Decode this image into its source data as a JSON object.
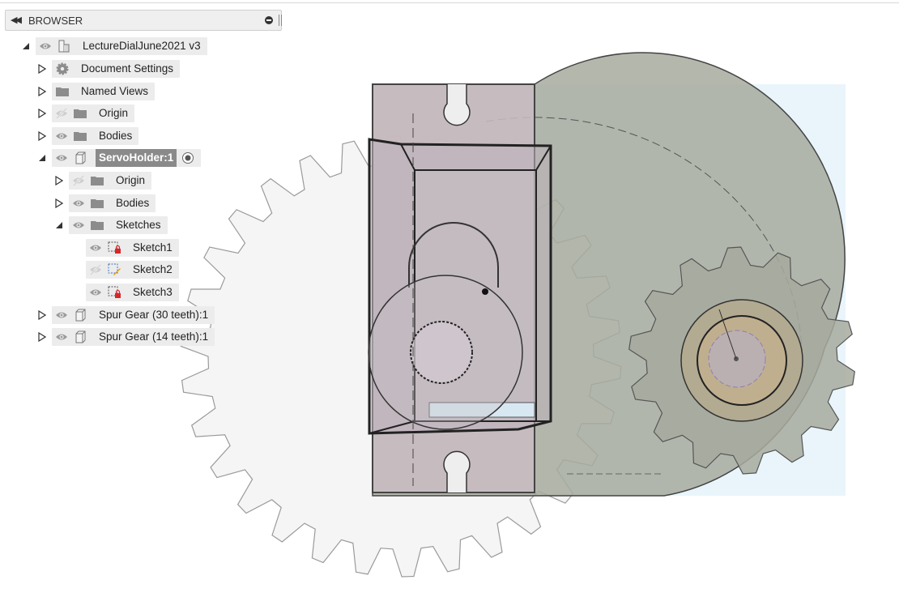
{
  "browser": {
    "title": "BROWSER",
    "collapse_icon": "double-left-arrow-icon",
    "pin_icon": "pin-icon"
  },
  "tree": {
    "root": {
      "label": "LectureDialJune2021 v3",
      "expanded": true
    },
    "items": [
      {
        "label": "Document Settings",
        "icon": "gear-icon",
        "expanded": false
      },
      {
        "label": "Named Views",
        "icon": "folder-icon",
        "expanded": false
      },
      {
        "label": "Origin",
        "icon": "folder-icon",
        "visible": false,
        "expanded": false
      },
      {
        "label": "Bodies",
        "icon": "folder-icon",
        "visible": true,
        "expanded": false
      },
      {
        "label": "ServoHolder:1",
        "icon": "component-icon",
        "visible": true,
        "expanded": true,
        "selected": true
      },
      {
        "label": "Origin",
        "icon": "folder-icon",
        "visible": false,
        "expanded": false
      },
      {
        "label": "Bodies",
        "icon": "folder-icon",
        "visible": true,
        "expanded": false
      },
      {
        "label": "Sketches",
        "icon": "folder-icon",
        "visible": true,
        "expanded": true
      },
      {
        "label": "Sketch1",
        "icon": "sketch-locked-icon",
        "visible": true
      },
      {
        "label": "Sketch2",
        "icon": "sketch-edit-icon",
        "visible": false
      },
      {
        "label": "Sketch3",
        "icon": "sketch-locked-icon",
        "visible": true
      },
      {
        "label": "Spur Gear (30 teeth):1",
        "icon": "component-icon",
        "visible": true,
        "expanded": false
      },
      {
        "label": "Spur Gear (14 teeth):1",
        "icon": "component-icon",
        "visible": true,
        "expanded": false
      }
    ]
  },
  "colors": {
    "panel": "#ececec",
    "selected": "#8a8a8a",
    "gear_large": "#f1f1f1",
    "plate": "#a4a699",
    "holder": "#cbbfc4",
    "sky": "#e9f5fb"
  }
}
